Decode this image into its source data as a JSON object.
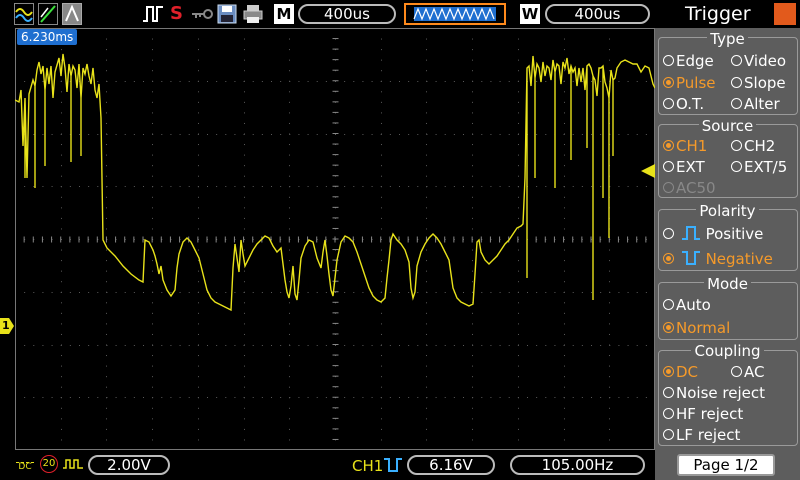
{
  "topbar": {
    "run_state_letter": "S",
    "timebase_main_label": "M",
    "timebase_main_value": "400us",
    "timebase_window_label": "W",
    "timebase_window_value": "400us",
    "accent_color": "#ff8a1c"
  },
  "screen": {
    "cursor_time": "6.230ms",
    "ch1_marker": "1",
    "trace_color": "#e8e21a",
    "grid_color": "#5a5a5a"
  },
  "bottombar": {
    "coupling_icon_top": "DC",
    "bw_limit": "20",
    "ch1_scale": "2.00V",
    "trigger_source": "CH1",
    "trigger_level": "6.16V",
    "frequency": "105.00Hz"
  },
  "panel": {
    "title": "Trigger",
    "close_label": "X",
    "type_header": "Type",
    "type_options": [
      {
        "label": "Edge",
        "selected": false
      },
      {
        "label": "Video",
        "selected": false
      },
      {
        "label": "Pulse",
        "selected": true
      },
      {
        "label": "Slope",
        "selected": false
      },
      {
        "label": "O.T.",
        "selected": false
      },
      {
        "label": "Alter",
        "selected": false
      }
    ],
    "source_header": "Source",
    "source_options": [
      {
        "label": "CH1",
        "selected": true
      },
      {
        "label": "CH2",
        "selected": false
      },
      {
        "label": "EXT",
        "selected": false
      },
      {
        "label": "EXT/5",
        "selected": false
      },
      {
        "label": "AC50",
        "selected": false
      }
    ],
    "polarity_header": "Polarity",
    "polarity_options": [
      {
        "label": "Positive",
        "selected": false
      },
      {
        "label": "Negative",
        "selected": true
      }
    ],
    "mode_header": "Mode",
    "mode_options": [
      {
        "label": "Auto",
        "selected": false
      },
      {
        "label": "Normal",
        "selected": true
      }
    ],
    "coupling_header": "Coupling",
    "coupling_options": [
      {
        "label": "DC",
        "selected": true
      },
      {
        "label": "AC",
        "selected": false
      },
      {
        "label": "Noise reject",
        "selected": false
      },
      {
        "label": "HF reject",
        "selected": false
      },
      {
        "label": "LF reject",
        "selected": false
      }
    ],
    "page_label": "Page 1/2"
  }
}
